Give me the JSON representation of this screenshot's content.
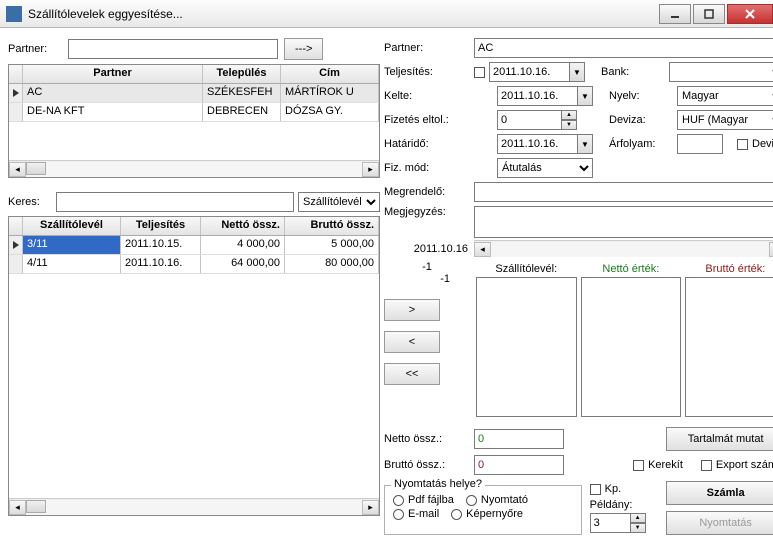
{
  "window": {
    "title": "Szállítólevelek eggyesítése..."
  },
  "left": {
    "partner_label": "Partner:",
    "partner_input": "",
    "arrow_btn": "--->",
    "partner_grid": {
      "headers": [
        "Partner",
        "Település",
        "Cím"
      ],
      "rows": [
        {
          "partner": "AC",
          "telepules": "SZÉKESFEH",
          "cim": "MÁRTÍROK U"
        },
        {
          "partner": "DE-NA KFT",
          "telepules": "DEBRECEN",
          "cim": "DÓZSA GY."
        }
      ]
    },
    "keres_label": "Keres:",
    "keres_input": "",
    "keres_select": "Szállítólevél",
    "sl_grid": {
      "headers": [
        "Szállítólevél",
        "Teljesítés",
        "Nettó össz.",
        "Bruttó össz."
      ],
      "rows": [
        {
          "sl": "3/11",
          "telj": "2011.10.15.",
          "netto": "4 000,00",
          "brutto": "5 000,00",
          "selected": true
        },
        {
          "sl": "4/11",
          "telj": "2011.10.16.",
          "netto": "64 000,00",
          "brutto": "80 000,00",
          "selected": false
        }
      ]
    }
  },
  "right": {
    "partner_label": "Partner:",
    "partner_value": "AC",
    "teljesites_label": "Teljesítés:",
    "teljesites_value": "2011.10.16.",
    "bank_label": "Bank:",
    "bank_value": "",
    "kelte_label": "Kelte:",
    "kelte_value": "2011.10.16.",
    "nyelv_label": "Nyelv:",
    "nyelv_value": "Magyar",
    "fizetes_label": "Fizetés eltol.:",
    "fizetes_value": "0",
    "deviza_label": "Deviza:",
    "deviza_value": "HUF (Magyar",
    "hatar_label": "Határidő:",
    "hatar_value": "2011.10.16.",
    "arfolyam_label": "Árfolyam:",
    "arfolyam_value": "",
    "deviza_chk": "Deviza",
    "fizmod_label": "Fiz. mód:",
    "fizmod_value": "Átutalás",
    "megrend_label": "Megrendelő:",
    "megrend_value": "",
    "megj_label": "Megjegyzés:",
    "megj_value": "",
    "date_note": "2011.10.16",
    "minus1a": "-1",
    "minus1b": "-1",
    "move_right": ">",
    "move_left": "<",
    "move_all_left": "<<",
    "col_sl": "Szállítólevél:",
    "col_netto": "Nettó érték:",
    "col_brutto": "Bruttó érték:",
    "netto_label": "Netto össz.:",
    "netto_value": "0",
    "brutto_label": "Bruttó össz.:",
    "brutto_value": "0",
    "tartalmat_btn": "Tartalmát mutat",
    "kerekit_chk": "Kerekít",
    "export_chk": "Export számla",
    "ny_legend": "Nyomtatás helye?",
    "r_pdf": "Pdf fájlba",
    "r_nyomtato": "Nyomtató",
    "r_email": "E-mail",
    "r_kepernyo": "Képernyőre",
    "kp_chk": "Kp.",
    "peldany_label": "Példány:",
    "peldany_value": "3",
    "szamla_btn": "Számla",
    "nyomtatas_btn": "Nyomtatás"
  }
}
